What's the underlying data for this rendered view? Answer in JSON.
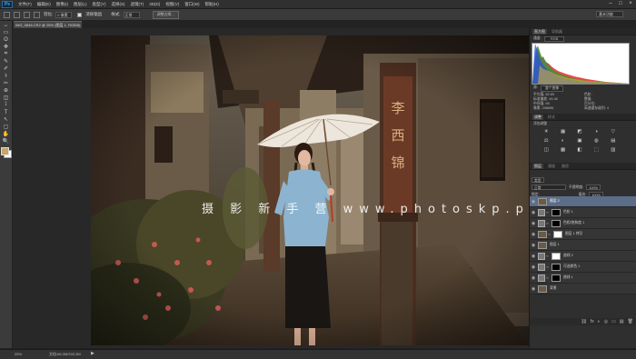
{
  "app": {
    "logo": "Ps"
  },
  "menu": [
    "文件(F)",
    "编辑(E)",
    "图像(I)",
    "图层(L)",
    "类型(Y)",
    "选择(S)",
    "滤镜(T)",
    "3D(D)",
    "视图(V)",
    "窗口(W)",
    "帮助(H)"
  ],
  "options_bar": {
    "feather_label": "羽化:",
    "feather_value": "0 像素",
    "antialias_label": "消除锯齿",
    "style_label": "样式:",
    "style_value": "正常",
    "refine_button": "调整边缘...",
    "workspace": "基本功能"
  },
  "document_tab": {
    "title": "IMG_0846.CR2 @ 25% (图层 1, RGB/8)",
    "close": "×"
  },
  "watermark": "摄 影 新 手 营 www.photoskp.p",
  "status": {
    "zoom": "25%",
    "doc": "文档:66.0M/203.3M",
    "arrow": "▶"
  },
  "panels": {
    "histogram_tabs": [
      "直方图",
      "导航器"
    ],
    "channel_label": "通道:",
    "channel_value": "RGB",
    "source_label": "源:",
    "source_value": "整个图像",
    "stats_left": [
      "平均值: 82.69",
      "标准偏差: 49.45",
      "中间值: 65",
      "像素: 208656"
    ],
    "stats_right": [
      "色阶:",
      "数量:",
      "百分位:",
      "高速缓存级别: 4"
    ],
    "adjustment_tabs": [
      "调整",
      "样式"
    ],
    "adjustment_hint": "添加调整",
    "adjustment_icons": [
      "☀",
      "▦",
      "◩",
      "◑",
      "▽",
      "⚖",
      "◐",
      "▣",
      "◍",
      "▤",
      "◫",
      "▩",
      "◧",
      "⬚",
      "▥"
    ],
    "layers_tabs": [
      "图层",
      "通道",
      "路径"
    ],
    "kind_label": "类型",
    "blend_mode": "正常",
    "opacity_label": "不透明度:",
    "opacity_value": "100%",
    "lock_label": "锁定:",
    "fill_label": "填充:",
    "fill_value": "100%",
    "layers": [
      {
        "name": "图层 2",
        "kind": "pixel",
        "selected": true
      },
      {
        "name": "色阶 1",
        "kind": "adj-black",
        "selected": false
      },
      {
        "name": "色相/饱和度 1",
        "kind": "adj-black",
        "selected": false
      },
      {
        "name": "图层 1 拷贝",
        "kind": "pixel-white",
        "selected": false
      },
      {
        "name": "图层 1",
        "kind": "pixel",
        "selected": false
      },
      {
        "name": "曲线 2",
        "kind": "adj-white",
        "selected": false
      },
      {
        "name": "可选颜色 1",
        "kind": "adj-black",
        "selected": false
      },
      {
        "name": "曲线 1",
        "kind": "adj-black",
        "selected": false
      },
      {
        "name": "背景",
        "kind": "pixel",
        "selected": false
      }
    ],
    "footer_icons": [
      "⛓",
      "fx",
      "◐",
      "◎",
      "▭",
      "▤",
      "🗑"
    ]
  },
  "tools": [
    "↔",
    "▭",
    "ʘ",
    "✥",
    "⌗",
    "✎",
    "✐",
    "⚕",
    "✂",
    "⊕",
    "◫",
    "⟟",
    "T",
    "↖",
    "▢",
    "✋",
    "🔍"
  ],
  "colors": {
    "fg": "#c8a46a",
    "bg": "#ffffff",
    "selected_layer": "#5b6d88"
  }
}
